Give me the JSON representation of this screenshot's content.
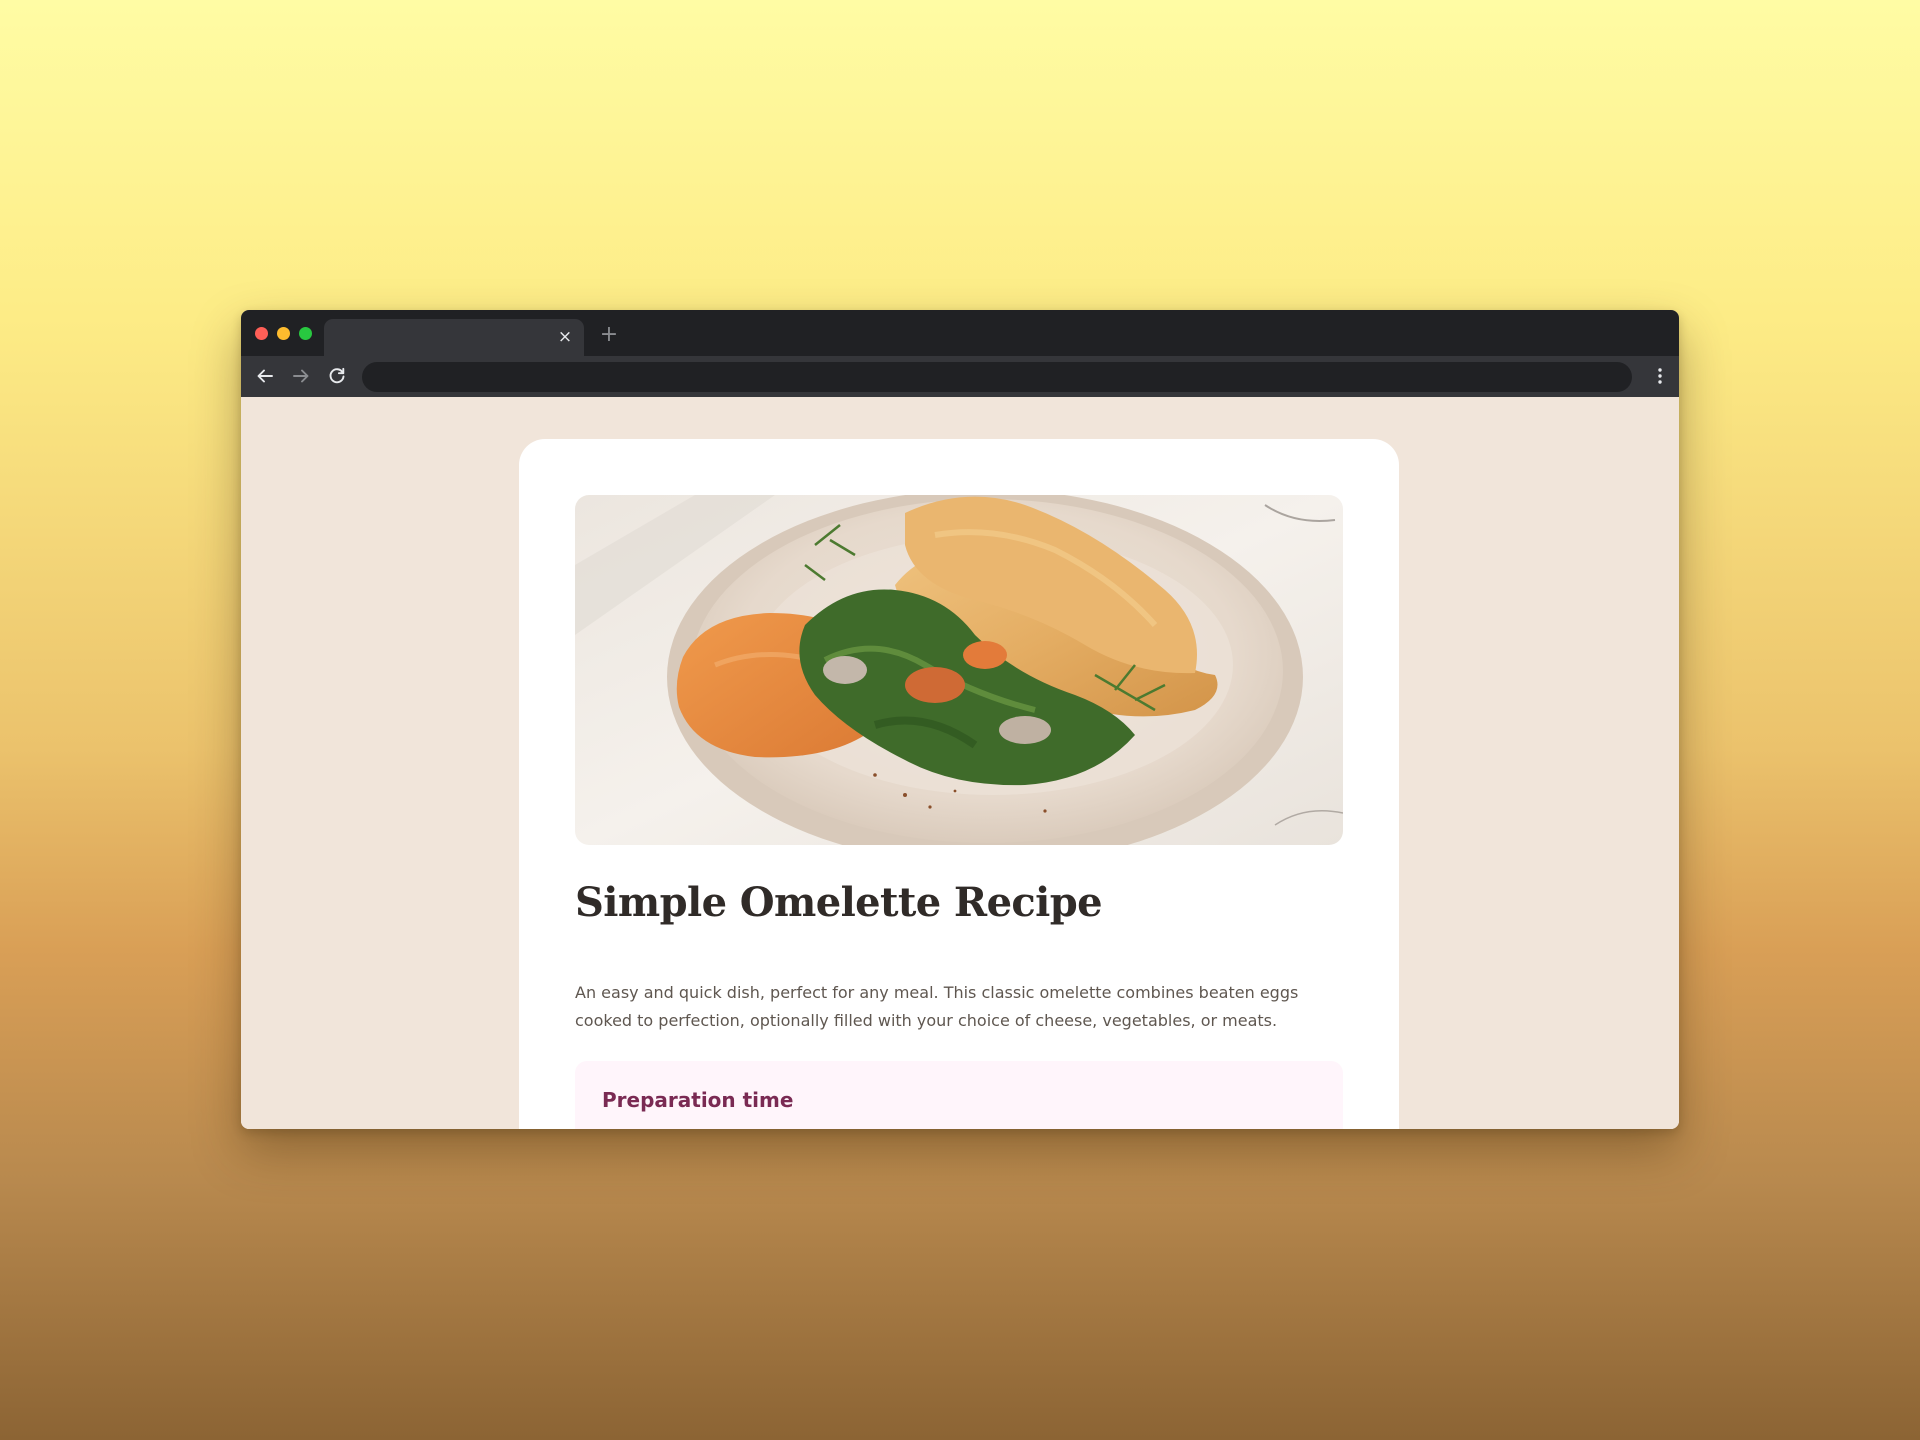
{
  "browser": {
    "tab": {
      "title": "",
      "close_icon": "close-icon"
    },
    "new_tab_icon": "plus-icon",
    "toolbar": {
      "back_icon": "arrow-left-icon",
      "forward_icon": "arrow-right-icon",
      "reload_icon": "reload-icon",
      "address_value": "",
      "menu_icon": "kebab-menu-icon"
    },
    "colors": {
      "titlebar": "#202124",
      "toolbar": "#35363a",
      "omnibox": "#202124",
      "close_dot": "#ff5f57",
      "minimize_dot": "#febc2e",
      "maximize_dot": "#28c840"
    }
  },
  "page": {
    "background": "#f1e5da",
    "card_background": "#ffffff",
    "image": {
      "alt": "Omelette with spinach, mushrooms and dill on a plate beside a smear of orange spread"
    },
    "title": "Simple Omelette Recipe",
    "description": "An easy and quick dish, perfect for any meal. This classic omelette combines beaten eggs cooked to perfection, optionally filled with your choice of cheese, vegetables, or meats.",
    "preparation": {
      "heading": "Preparation time",
      "heading_color": "#7a2a53",
      "box_color": "#fff5fb"
    }
  }
}
